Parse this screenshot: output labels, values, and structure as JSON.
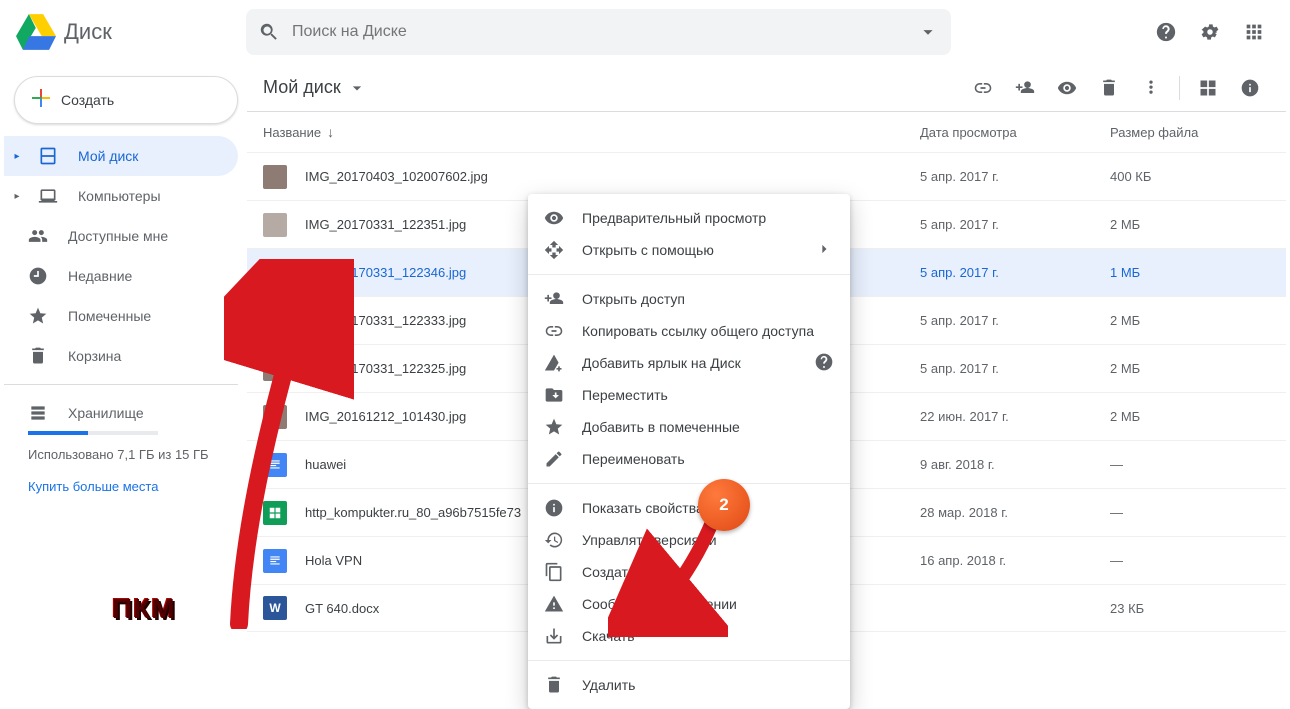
{
  "app": {
    "title": "Диск"
  },
  "search": {
    "placeholder": "Поиск на Диске"
  },
  "create_button": "Создать",
  "sidebar": {
    "items": [
      {
        "label": "Мой диск"
      },
      {
        "label": "Компьютеры"
      },
      {
        "label": "Доступные мне"
      },
      {
        "label": "Недавние"
      },
      {
        "label": "Помеченные"
      },
      {
        "label": "Корзина"
      }
    ],
    "storage": {
      "title": "Хранилище",
      "used_text": "Использовано 7,1 ГБ из 15 ГБ",
      "buy_link": "Купить больше места"
    }
  },
  "breadcrumb": "Мой диск",
  "columns": {
    "name": "Название",
    "date": "Дата просмотра",
    "size": "Размер файла"
  },
  "files": [
    {
      "name": "IMG_20170403_102007602.jpg",
      "date": "5 апр. 2017 г.",
      "size": "400 КБ"
    },
    {
      "name": "IMG_20170331_122351.jpg",
      "date": "5 апр. 2017 г.",
      "size": "2 МБ"
    },
    {
      "name": "IMG_20170331_122346.jpg",
      "date": "5 апр. 2017 г.",
      "size": "1 МБ"
    },
    {
      "name": "IMG_20170331_122333.jpg",
      "date": "5 апр. 2017 г.",
      "size": "2 МБ"
    },
    {
      "name": "IMG_20170331_122325.jpg",
      "date": "5 апр. 2017 г.",
      "size": "2 МБ"
    },
    {
      "name": "IMG_20161212_101430.jpg",
      "date": "22 июн. 2017 г.",
      "size": "2 МБ"
    },
    {
      "name": "huawei",
      "date": "9 авг. 2018 г.",
      "size": "—"
    },
    {
      "name": "http_kompukter.ru_80_a96b7515fe73",
      "date": "28 мар. 2018 г.",
      "size": "—"
    },
    {
      "name": "Hola VPN",
      "date": "16 апр. 2018 г.",
      "size": "—"
    },
    {
      "name": "GT 640.docx",
      "date": "",
      "size": "23 КБ"
    }
  ],
  "context_menu": [
    {
      "label": "Предварительный просмотр",
      "icon": "eye"
    },
    {
      "label": "Открыть с помощью",
      "icon": "open-with",
      "sub": true
    },
    {
      "sep": true
    },
    {
      "label": "Открыть доступ",
      "icon": "person-add"
    },
    {
      "label": "Копировать ссылку общего доступа",
      "icon": "link"
    },
    {
      "label": "Добавить ярлык на Диск",
      "icon": "drive-add",
      "info": true
    },
    {
      "label": "Переместить",
      "icon": "move"
    },
    {
      "label": "Добавить в помеченные",
      "icon": "star"
    },
    {
      "label": "Переименовать",
      "icon": "rename"
    },
    {
      "sep": true
    },
    {
      "label": "Показать свойства",
      "icon": "info"
    },
    {
      "label": "Управлять версиями",
      "icon": "versions"
    },
    {
      "label": "Создать копию",
      "icon": "copy"
    },
    {
      "label": "Сообщить о нарушении",
      "icon": "report"
    },
    {
      "label": "Скачать",
      "icon": "download"
    },
    {
      "sep": true
    },
    {
      "label": "Удалить",
      "icon": "trash"
    }
  ],
  "annotations": {
    "pkm": "ПКМ",
    "badge": "2"
  }
}
